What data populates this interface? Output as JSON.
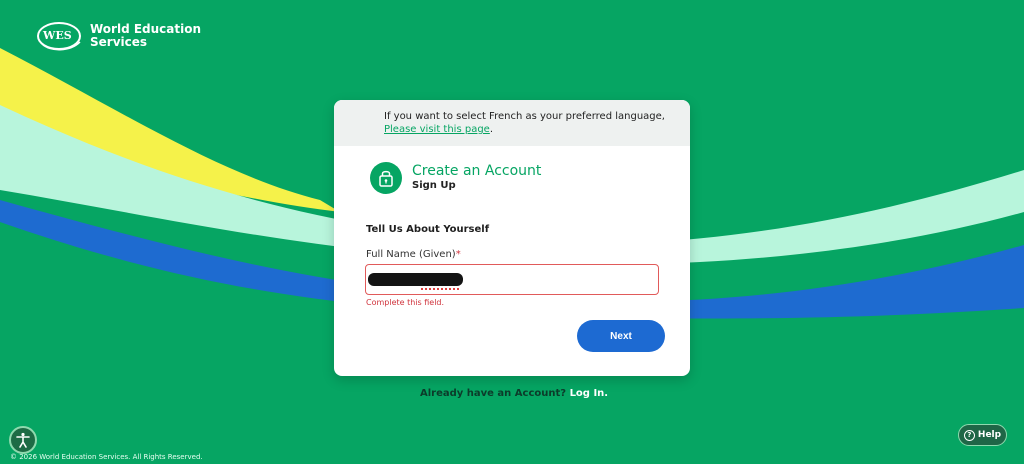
{
  "brand": {
    "logo_mark": "WES",
    "name_line1": "World Education",
    "name_line2": "Services"
  },
  "notice": {
    "text": "If you want to select French as your preferred language,",
    "link": "Please visit this page",
    "link_suffix": "."
  },
  "header": {
    "title": "Create an Account",
    "subtitle": "Sign Up",
    "icon": "lock-icon"
  },
  "form": {
    "section_title": "Tell Us About Yourself",
    "field_label": "Full Name (Given)",
    "required_marker": "*",
    "error": "Complete this field.",
    "next_label": "Next"
  },
  "footer": {
    "login_prompt": "Already have an Account?",
    "login_link": "Log In.",
    "copyright": "© 2026 World Education Services. All Rights Reserved.",
    "help_label": "Help"
  },
  "colors": {
    "background": "#06a563",
    "primary_button": "#1d6ad2",
    "error": "#d0343d"
  }
}
